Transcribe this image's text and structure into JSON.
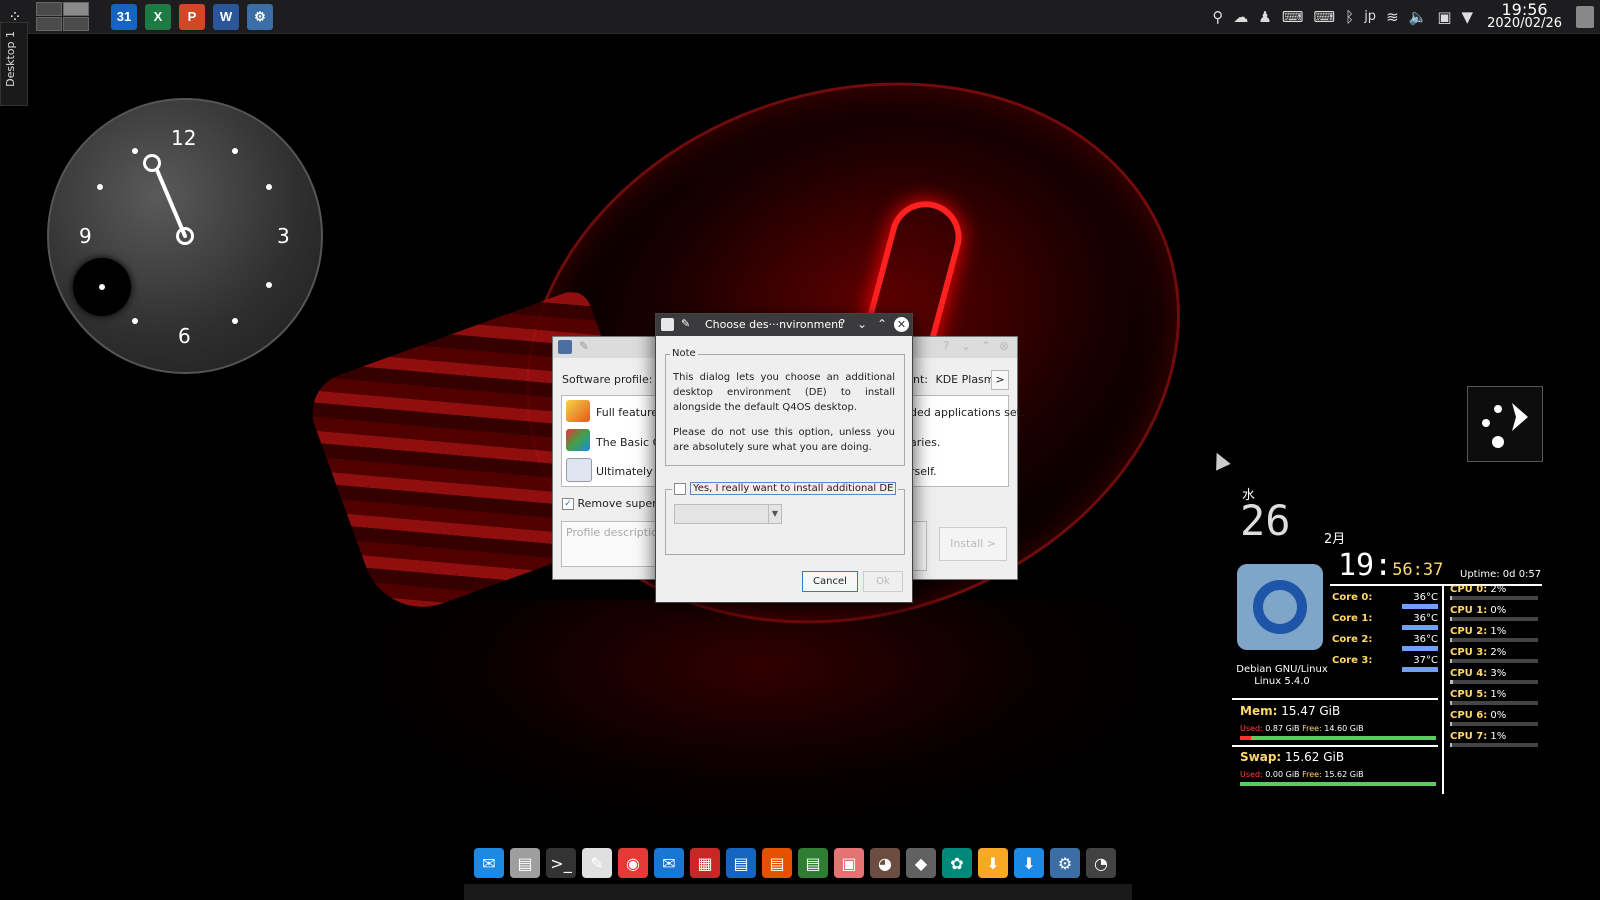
{
  "top_panel": {
    "workspace_pager": {
      "desktops": 4,
      "active": 2
    },
    "launchers": [
      {
        "name": "calendar-icon",
        "label": "31",
        "color": "#1565c0"
      },
      {
        "name": "excel-icon",
        "label": "X",
        "color": "#1d7a43"
      },
      {
        "name": "powerpoint-icon",
        "label": "P",
        "color": "#d24726"
      },
      {
        "name": "word-icon",
        "label": "W",
        "color": "#2b579a"
      },
      {
        "name": "settings-icon",
        "label": "⚙",
        "color": "#3a6ea5"
      }
    ],
    "tray": {
      "language": "jp",
      "time": "19:56",
      "date": "2020/02/26"
    }
  },
  "side_tab": {
    "label": "Desktop 1"
  },
  "analog_clock": {
    "numbers": {
      "twelve": "12",
      "three": "3",
      "six": "6",
      "nine": "9"
    }
  },
  "bg_window": {
    "software_profile_label": "Software profile:",
    "asterisk": "*",
    "destination_label": "nt:",
    "destination_value": "KDE Plasma",
    "destination_button": ">",
    "items": [
      {
        "left": "Full featured",
        "right": "ded applications set."
      },
      {
        "left": "The Basic Q",
        "right": "aries."
      },
      {
        "left": "Ultimately m",
        "right": "rself."
      }
    ],
    "remove_label": "Remove superflu",
    "description_placeholder": "Profile description",
    "install_button": "Install >"
  },
  "dialog": {
    "title": "Choose des···nvironment",
    "help": "?",
    "note_legend": "Note",
    "note_paragraph_1": "This dialog lets you choose an additional desktop environment (DE) to install alongside the default Q4OS desktop.",
    "note_paragraph_2": "Please do not use this option, unless you are absolutely sure what you are doing.",
    "checkbox_label": "Yes, I really want to install additional DE",
    "checkbox_checked": false,
    "combo_value": "",
    "cancel_button": "Cancel",
    "ok_button": "Ok"
  },
  "conky": {
    "day_of_week": "水",
    "day": "26",
    "month": "2月",
    "time_hm": "19:",
    "time_ms": "56:37",
    "uptime": "Uptime: 0d 0:57",
    "os_name": "Debian GNU/Linux",
    "kernel": "Linux 5.4.0",
    "cores": [
      {
        "label": "Core 0:",
        "temp": "36°C"
      },
      {
        "label": "Core 1:",
        "temp": "36°C"
      },
      {
        "label": "Core 2:",
        "temp": "36°C"
      },
      {
        "label": "Core 3:",
        "temp": "37°C"
      }
    ],
    "cpus": [
      {
        "label": "CPU 0:",
        "value": "2%",
        "pct": 2
      },
      {
        "label": "CPU 1:",
        "value": "0%",
        "pct": 0
      },
      {
        "label": "CPU 2:",
        "value": "1%",
        "pct": 1
      },
      {
        "label": "CPU 3:",
        "value": "2%",
        "pct": 2
      },
      {
        "label": "CPU 4:",
        "value": "3%",
        "pct": 3
      },
      {
        "label": "CPU 5:",
        "value": "1%",
        "pct": 1
      },
      {
        "label": "CPU 6:",
        "value": "0%",
        "pct": 0
      },
      {
        "label": "CPU 7:",
        "value": "1%",
        "pct": 1
      }
    ],
    "mem": {
      "label": "Mem:",
      "total": "15.47 GiB",
      "used_label": "Used:",
      "used": "0.87 GiB",
      "free_label": "Free:",
      "free": "14.60 GiB",
      "used_fraction": 0.056
    },
    "swap": {
      "label": "Swap:",
      "total": "15.62 GiB",
      "used_label": "Used:",
      "used": "0.00 GiB",
      "free_label": "Free:",
      "free": "15.62 GiB"
    }
  },
  "dock": {
    "items": [
      {
        "name": "welcome-icon",
        "glyph": "✉",
        "color": "#1e88e5"
      },
      {
        "name": "file-manager-icon",
        "glyph": "▤",
        "color": "#9e9e9e"
      },
      {
        "name": "terminal-icon",
        "glyph": ">_",
        "color": "#333333"
      },
      {
        "name": "text-editor-icon",
        "glyph": "✎",
        "color": "#e0e0e0"
      },
      {
        "name": "chrome-icon",
        "glyph": "◉",
        "color": "#e53935"
      },
      {
        "name": "thunderbird-icon",
        "glyph": "✉",
        "color": "#1976d2"
      },
      {
        "name": "document-viewer-icon",
        "glyph": "▦",
        "color": "#c62828"
      },
      {
        "name": "writer-icon",
        "glyph": "▤",
        "color": "#1565c0"
      },
      {
        "name": "impress-icon",
        "glyph": "▤",
        "color": "#e65100"
      },
      {
        "name": "calc-icon",
        "glyph": "▤",
        "color": "#2e7d32"
      },
      {
        "name": "image-viewer-icon",
        "glyph": "▣",
        "color": "#e57373"
      },
      {
        "name": "gimp-icon",
        "glyph": "◕",
        "color": "#6d4c41"
      },
      {
        "name": "software-center-icon",
        "glyph": "◆",
        "color": "#616161"
      },
      {
        "name": "system-tool-icon",
        "glyph": "✿",
        "color": "#00897b"
      },
      {
        "name": "download-icon",
        "glyph": "⬇",
        "color": "#f9a825"
      },
      {
        "name": "installer-icon",
        "glyph": "⬇",
        "color": "#1e88e5"
      },
      {
        "name": "control-panel-icon",
        "glyph": "⚙",
        "color": "#3a6ea5"
      },
      {
        "name": "dark-clock-icon",
        "glyph": "◔",
        "color": "#424242"
      }
    ]
  }
}
